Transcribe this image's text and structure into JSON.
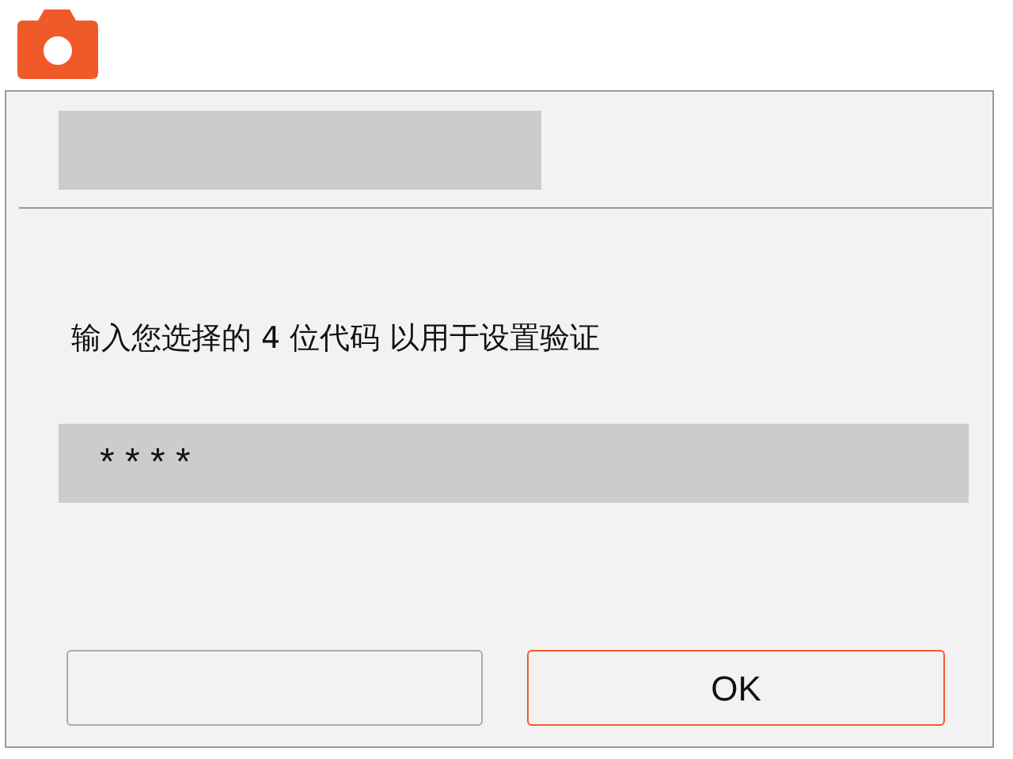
{
  "dialog": {
    "prompt": "输入您选择的 4 位代码 以用于设置验证",
    "pin_field": {
      "value": "* * * *"
    },
    "buttons": [
      {
        "kind": "blank"
      },
      {
        "kind": "primary",
        "label": "OK"
      }
    ]
  }
}
